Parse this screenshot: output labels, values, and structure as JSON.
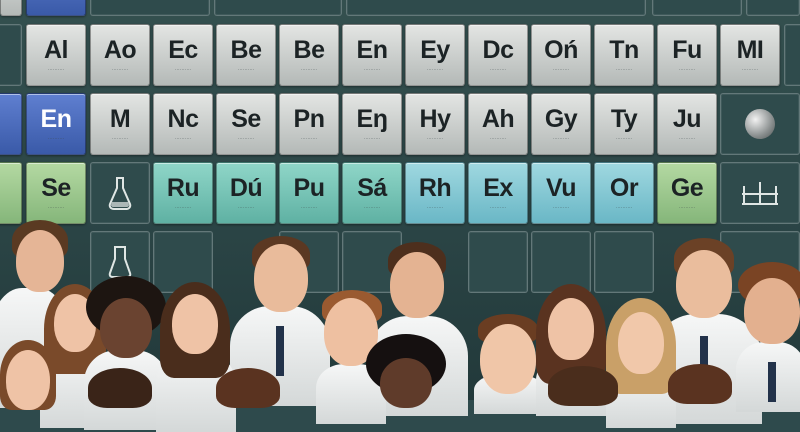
{
  "tiles": {
    "row1": [
      {
        "symbol": "Al",
        "color": "gray"
      },
      {
        "symbol": "Ao",
        "color": "gray"
      },
      {
        "symbol": "Ec",
        "color": "gray"
      },
      {
        "symbol": "Be",
        "color": "gray"
      },
      {
        "symbol": "Be",
        "color": "gray"
      },
      {
        "symbol": "En",
        "color": "gray"
      },
      {
        "symbol": "Ey",
        "color": "gray"
      },
      {
        "symbol": "Dc",
        "color": "gray"
      },
      {
        "symbol": "Oń",
        "color": "gray"
      },
      {
        "symbol": "Tn",
        "color": "gray"
      },
      {
        "symbol": "Fu",
        "color": "gray"
      },
      {
        "symbol": "MI",
        "color": "gray"
      }
    ],
    "row2": [
      {
        "symbol": "En",
        "color": "blue"
      },
      {
        "symbol": "M",
        "color": "gray"
      },
      {
        "symbol": "Nc",
        "color": "gray"
      },
      {
        "symbol": "Se",
        "color": "gray"
      },
      {
        "symbol": "Pn",
        "color": "gray"
      },
      {
        "symbol": "Eŋ",
        "color": "gray"
      },
      {
        "symbol": "Hy",
        "color": "gray"
      },
      {
        "symbol": "Ah",
        "color": "gray"
      },
      {
        "symbol": "Gy",
        "color": "gray"
      },
      {
        "symbol": "Ty",
        "color": "gray"
      },
      {
        "symbol": "Ju",
        "color": "gray"
      }
    ],
    "row3": [
      {
        "symbol": "Se",
        "color": "green"
      },
      {
        "symbol": "Ru",
        "color": "teal"
      },
      {
        "symbol": "Dú",
        "color": "teal"
      },
      {
        "symbol": "Pu",
        "color": "teal"
      },
      {
        "symbol": "Sá",
        "color": "teal"
      },
      {
        "symbol": "Rh",
        "color": "cyan"
      },
      {
        "symbol": "Ex",
        "color": "cyan"
      },
      {
        "symbol": "Vu",
        "color": "cyan"
      },
      {
        "symbol": "Or",
        "color": "cyan"
      },
      {
        "symbol": "Ge",
        "color": "green"
      }
    ]
  },
  "icons": {
    "flask": "flask-icon",
    "beaker": "beaker-icon",
    "test_tube_rack": "test-tube-rack-icon",
    "molecule": "molecule-icon",
    "sphere": "sphere-icon"
  },
  "colors": {
    "wall": "#2e4a4c",
    "tile_gray": "#cdd1cf",
    "tile_blue": "#4a6bbb",
    "tile_teal": "#78c4b6",
    "tile_cyan": "#86c8d3",
    "tile_green": "#9ec88e",
    "lab_coat": "#f2f3f3"
  }
}
